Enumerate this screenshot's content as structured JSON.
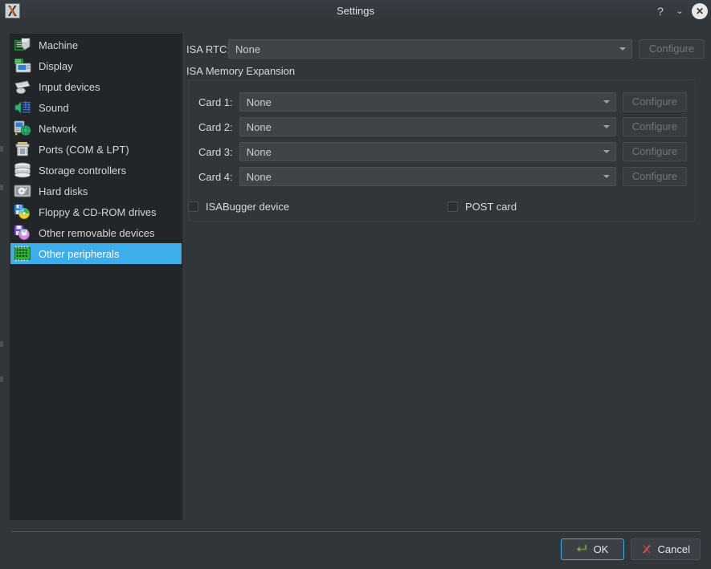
{
  "window": {
    "title": "Settings",
    "app_icon": "app-86box-icon",
    "controls": {
      "help": "?",
      "menu": "⌄",
      "close": "✕"
    }
  },
  "sidebar": {
    "items": [
      {
        "label": "Machine",
        "icon": "machine-icon",
        "selected": false
      },
      {
        "label": "Display",
        "icon": "display-icon",
        "selected": false
      },
      {
        "label": "Input devices",
        "icon": "input-devices-icon",
        "selected": false
      },
      {
        "label": "Sound",
        "icon": "sound-icon",
        "selected": false
      },
      {
        "label": "Network",
        "icon": "network-icon",
        "selected": false
      },
      {
        "label": "Ports (COM & LPT)",
        "icon": "ports-icon",
        "selected": false
      },
      {
        "label": "Storage controllers",
        "icon": "storage-controllers-icon",
        "selected": false
      },
      {
        "label": "Hard disks",
        "icon": "hard-disks-icon",
        "selected": false
      },
      {
        "label": "Floppy & CD-ROM drives",
        "icon": "floppy-cdrom-icon",
        "selected": false
      },
      {
        "label": "Other removable devices",
        "icon": "other-removable-icon",
        "selected": false
      },
      {
        "label": "Other peripherals",
        "icon": "other-peripherals-icon",
        "selected": true
      }
    ]
  },
  "main": {
    "isa_rtc": {
      "label": "ISA RTC:",
      "value": "None",
      "configure_label": "Configure"
    },
    "isa_memory_expansion": {
      "title": "ISA Memory Expansion",
      "cards": [
        {
          "label": "Card 1:",
          "value": "None",
          "configure_label": "Configure"
        },
        {
          "label": "Card 2:",
          "value": "None",
          "configure_label": "Configure"
        },
        {
          "label": "Card 3:",
          "value": "None",
          "configure_label": "Configure"
        },
        {
          "label": "Card 4:",
          "value": "None",
          "configure_label": "Configure"
        }
      ]
    },
    "checkboxes": [
      {
        "label": "ISABugger device",
        "checked": false
      },
      {
        "label": "POST card",
        "checked": false
      }
    ]
  },
  "footer": {
    "ok_label": "OK",
    "cancel_label": "Cancel",
    "ok_icon": "enter-arrow-icon",
    "cancel_icon": "red-x-icon"
  },
  "colors": {
    "window_bg": "#31363b",
    "sidebar_bg": "#232629",
    "selection": "#3daee9",
    "field_bg": "#3f4449",
    "text": "#d6dade",
    "disabled_text": "#6f757b"
  }
}
